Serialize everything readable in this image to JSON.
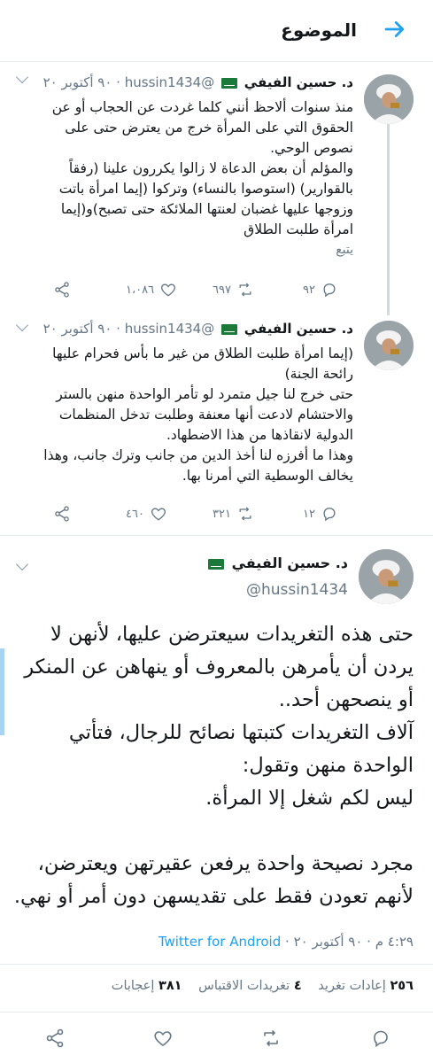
{
  "header": {
    "title": "الموضوع"
  },
  "tweets": [
    {
      "name": "د. حسين الفيفي",
      "handle": "@hussin1434",
      "time": "· ٩٠ أكتوبر ٢٠",
      "lines": [
        "منذ سنوات ألاحظ أنني كلما غردت عن الحجاب أو عن",
        "الحقوق التي على المرأة خرج من يعترض حتى على",
        "نصوص الوحي.",
        "والمؤلم أن بعض الدعاة لا زالوا يكررون علينا (رفقاً",
        "بالقوارير) (استوصوا بالنساء) وتركوا (إيما امرأة باتت",
        "وزوجها عليها غضبان لعنتها الملائكة حتى تصبح)و(إيما",
        "امرأة طلبت الطلاق"
      ],
      "more": "يتبع",
      "replies": "٩٢",
      "retweets": "٦٩٧",
      "likes": "١،٠٨٦"
    },
    {
      "name": "د. حسين الفيفي",
      "handle": "@hussin1434",
      "time": "· ٩٠ أكتوبر ٢٠",
      "lines": [
        "(إيما امرأة طلبت الطلاق من غير ما بأس فحرام عليها",
        "رائحة الجنة)",
        "حتى خرج لنا جيل متمرد لو تأمر الواحدة منهن بالستر",
        "والاحتشام لادعت أنها معنفة وطلبت تدخل المنظمات",
        "الدولية لانقاذها من هذا الاضطهاد.",
        "وهذا ما أفرزه لنا أخذ الدين من جانب وترك جانب، وهذا",
        "يخالف الوسطية التي أمرنا بها."
      ],
      "replies": "١٢",
      "retweets": "٣٢١",
      "likes": "٤٦٠"
    }
  ],
  "main": {
    "name": "د. حسين الفيفي",
    "handle": "@hussin1434",
    "lines": [
      "حتى هذه التغريدات سيعترضن عليها، لأنهن لا",
      "يردن أن يأمرهن بالمعروف أو ينهاهن عن المنكر",
      "أو ينصحهن أحد..",
      "آلاف التغريدات كتبتها نصائح للرجال، فتأتي",
      "الواحدة منهن وتقول:",
      "ليس لكم شغل إلا المرأة.",
      "",
      "مجرد نصيحة واحدة يرفعن عقيرتهن ويعترضن،",
      "لأنهم تعودن فقط على تقديسهن دون أمر أو نهي."
    ],
    "timestamp": "٤:٢٩ م · ٩٠ أكتوبر ٢٠ ·",
    "source": "Twitter for Android",
    "stats": {
      "retweets_count": "٢٥٦",
      "retweets_label": "إعادات تغريد",
      "quotes_count": "٤",
      "quotes_label": "تغريدات الاقتباس",
      "likes_count": "٣٨١",
      "likes_label": "إعجابات"
    }
  },
  "colors": {
    "accent": "#1da1f2",
    "muted": "#657786",
    "flag": "#1b7a3a"
  }
}
